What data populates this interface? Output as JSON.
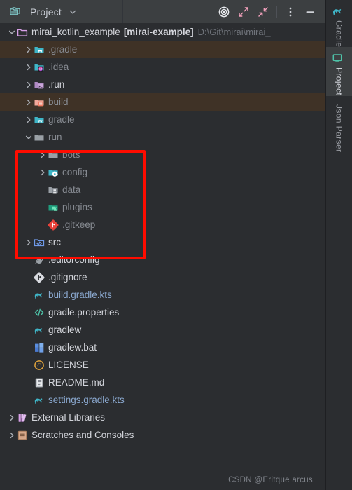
{
  "window": {
    "tool_window_title": "Project",
    "dropdown_icon": "chevron-down-icon",
    "title_icon": "project-folder-icon"
  },
  "toolbar": {
    "buttons": [
      {
        "name": "select-opened-file-button",
        "icon": "target-icon",
        "label": "Select Opened File"
      },
      {
        "name": "expand-all-button",
        "icon": "expand-arrows-icon",
        "label": "Expand All"
      },
      {
        "name": "collapse-all-button",
        "icon": "collapse-arrows-icon",
        "label": "Collapse All"
      },
      {
        "name": "options-menu-button",
        "icon": "kebab-menu-icon",
        "label": "Options"
      },
      {
        "name": "hide-button",
        "icon": "minimize-icon",
        "label": "Hide"
      }
    ]
  },
  "sidebar": {
    "tabs": [
      {
        "label": "Gradle",
        "icon": "gradle-elephant-icon",
        "active": false
      },
      {
        "label": "Project",
        "icon": "project-monitor-icon",
        "active": true
      },
      {
        "label": "Json Parser",
        "icon": "none",
        "active": false
      }
    ]
  },
  "tree": {
    "root": {
      "name": "mirai_kotlin_example",
      "module": "[mirai-example]",
      "path": "D:\\Git\\mirai\\mirai_",
      "icon": "module-folder-icon",
      "chevron": "chevron-down-icon"
    },
    "nodes": [
      {
        "label": ".gradle",
        "icon": "gradle-folder-icon",
        "chevron": "chevron-right-icon",
        "depth": 1,
        "style": "muted",
        "excluded": true
      },
      {
        "label": ".idea",
        "icon": "idea-folder-icon",
        "chevron": "chevron-right-icon",
        "depth": 1,
        "style": "muted",
        "excluded": false
      },
      {
        "label": ".run",
        "icon": "run-folder-icon",
        "chevron": "chevron-right-icon",
        "depth": 1,
        "style": "white",
        "excluded": false
      },
      {
        "label": "build",
        "icon": "build-folder-icon",
        "chevron": "chevron-right-icon",
        "depth": 1,
        "style": "muted",
        "excluded": true
      },
      {
        "label": "gradle",
        "icon": "gradle-folder-icon",
        "chevron": "chevron-right-icon",
        "depth": 1,
        "style": "muted",
        "excluded": false
      },
      {
        "label": "run",
        "icon": "plain-folder-icon",
        "chevron": "chevron-down-icon",
        "depth": 1,
        "style": "muted",
        "excluded": false
      },
      {
        "label": "bots",
        "icon": "plain-folder-icon",
        "chevron": "chevron-right-icon",
        "depth": 2,
        "style": "muted",
        "excluded": false
      },
      {
        "label": "config",
        "icon": "config-folder-icon",
        "chevron": "chevron-right-icon",
        "depth": 2,
        "style": "muted",
        "excluded": false
      },
      {
        "label": "data",
        "icon": "data-folder-icon",
        "chevron": "none",
        "depth": 2,
        "style": "muted",
        "excluded": false
      },
      {
        "label": "plugins",
        "icon": "plugins-folder-icon",
        "chevron": "none",
        "depth": 2,
        "style": "muted",
        "excluded": false
      },
      {
        "label": ".gitkeep",
        "icon": "git-file-icon",
        "chevron": "none",
        "depth": 2,
        "style": "muted",
        "excluded": false
      },
      {
        "label": "src",
        "icon": "source-folder-icon",
        "chevron": "chevron-right-icon",
        "depth": 1,
        "style": "white",
        "excluded": false
      },
      {
        "label": ".editorconfig",
        "icon": "editorconfig-icon",
        "chevron": "none",
        "depth": 1,
        "style": "white",
        "excluded": false
      },
      {
        "label": ".gitignore",
        "icon": "git-ignore-icon",
        "chevron": "none",
        "depth": 1,
        "style": "white",
        "excluded": false
      },
      {
        "label": "build.gradle.kts",
        "icon": "gradle-script-icon",
        "chevron": "none",
        "depth": 1,
        "style": "blue",
        "excluded": false
      },
      {
        "label": "gradle.properties",
        "icon": "properties-icon",
        "chevron": "none",
        "depth": 1,
        "style": "white",
        "excluded": false
      },
      {
        "label": "gradlew",
        "icon": "gradle-script-icon",
        "chevron": "none",
        "depth": 1,
        "style": "white",
        "excluded": false
      },
      {
        "label": "gradlew.bat",
        "icon": "windows-bat-icon",
        "chevron": "none",
        "depth": 1,
        "style": "white",
        "excluded": false
      },
      {
        "label": "LICENSE",
        "icon": "license-icon",
        "chevron": "none",
        "depth": 1,
        "style": "white",
        "excluded": false
      },
      {
        "label": "README.md",
        "icon": "markdown-icon",
        "chevron": "none",
        "depth": 1,
        "style": "white",
        "excluded": false
      },
      {
        "label": "settings.gradle.kts",
        "icon": "gradle-script-icon",
        "chevron": "none",
        "depth": 1,
        "style": "blue",
        "excluded": false
      },
      {
        "label": "External Libraries",
        "icon": "libraries-icon",
        "chevron": "chevron-right-icon",
        "depth": 0,
        "style": "white",
        "excluded": false
      },
      {
        "label": "Scratches and Consoles",
        "icon": "scratches-icon",
        "chevron": "chevron-right-icon",
        "depth": 0,
        "style": "white",
        "excluded": false
      }
    ]
  },
  "annotation": {
    "shape": "rectangle",
    "color": "#ff0c00"
  },
  "watermark": {
    "text": "CSDN @Eritque arcus"
  },
  "colors": {
    "background": "#2b2d30",
    "header": "#3c3f41",
    "excluded_row": "#3f3226",
    "text": "#bcbec4",
    "muted_text": "#868a91",
    "blue_text": "#8ba9d0",
    "accent_pink": "#f2a0bb",
    "teal": "#3fb6c8",
    "annotation_red": "#ff0c00"
  }
}
